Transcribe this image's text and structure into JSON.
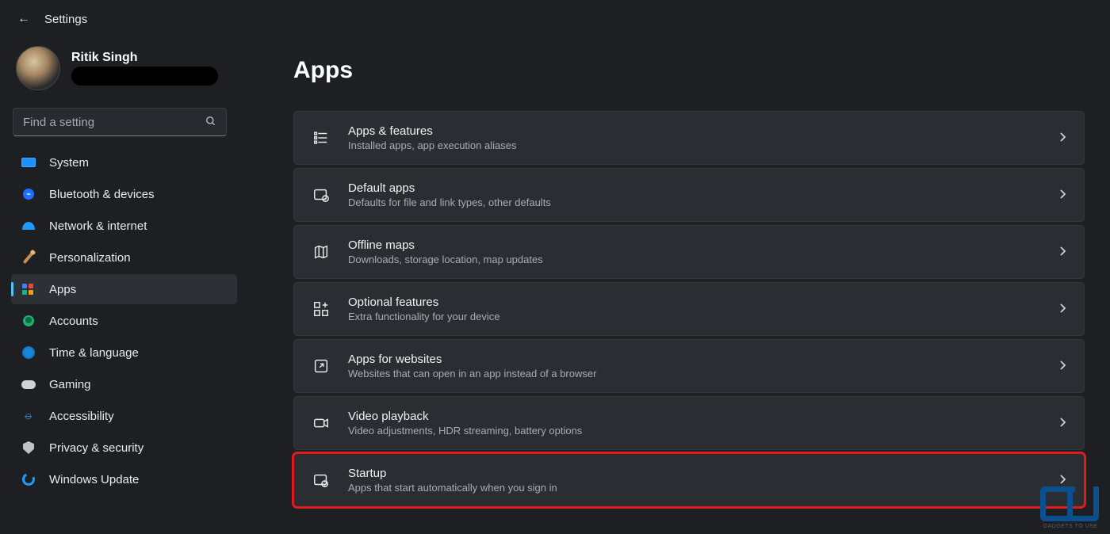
{
  "topbar": {
    "title": "Settings"
  },
  "profile": {
    "name": "Ritik Singh"
  },
  "search": {
    "placeholder": "Find a setting"
  },
  "nav": [
    {
      "id": "system",
      "label": "System",
      "icon": "system"
    },
    {
      "id": "bluetooth",
      "label": "Bluetooth & devices",
      "icon": "bt"
    },
    {
      "id": "network",
      "label": "Network & internet",
      "icon": "net"
    },
    {
      "id": "personalization",
      "label": "Personalization",
      "icon": "pers"
    },
    {
      "id": "apps",
      "label": "Apps",
      "icon": "apps",
      "active": true
    },
    {
      "id": "accounts",
      "label": "Accounts",
      "icon": "acct"
    },
    {
      "id": "time",
      "label": "Time & language",
      "icon": "time"
    },
    {
      "id": "gaming",
      "label": "Gaming",
      "icon": "game"
    },
    {
      "id": "accessibility",
      "label": "Accessibility",
      "icon": "access"
    },
    {
      "id": "privacy",
      "label": "Privacy & security",
      "icon": "priv"
    },
    {
      "id": "update",
      "label": "Windows Update",
      "icon": "wu"
    }
  ],
  "page": {
    "title": "Apps"
  },
  "cards": [
    {
      "id": "apps-features",
      "title": "Apps & features",
      "sub": "Installed apps, app execution aliases",
      "icon": "list"
    },
    {
      "id": "default-apps",
      "title": "Default apps",
      "sub": "Defaults for file and link types, other defaults",
      "icon": "default"
    },
    {
      "id": "offline-maps",
      "title": "Offline maps",
      "sub": "Downloads, storage location, map updates",
      "icon": "map"
    },
    {
      "id": "optional-features",
      "title": "Optional features",
      "sub": "Extra functionality for your device",
      "icon": "plus-grid"
    },
    {
      "id": "apps-websites",
      "title": "Apps for websites",
      "sub": "Websites that can open in an app instead of a browser",
      "icon": "open-ext"
    },
    {
      "id": "video-playback",
      "title": "Video playback",
      "sub": "Video adjustments, HDR streaming, battery options",
      "icon": "video"
    },
    {
      "id": "startup",
      "title": "Startup",
      "sub": "Apps that start automatically when you sign in",
      "icon": "startup",
      "highlight": true
    }
  ],
  "watermark": {
    "text": "GADGETS TO USE"
  }
}
